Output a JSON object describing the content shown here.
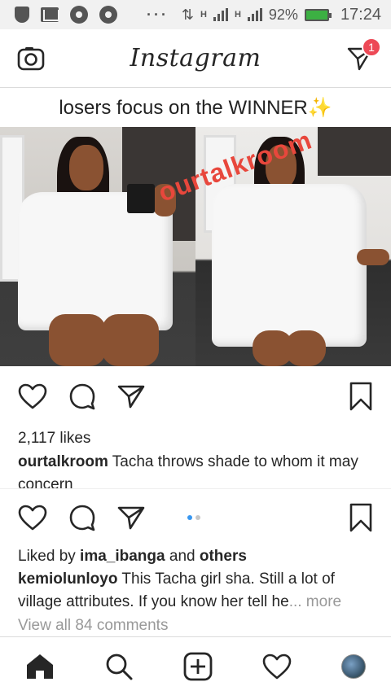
{
  "status_bar": {
    "battery_percent": "92%",
    "time": "17:24",
    "network_label_1": "H",
    "network_label_2": "H"
  },
  "header": {
    "logo": "Instagram",
    "notification_count": "1"
  },
  "post": {
    "banner_text": "losers focus on the WINNER✨",
    "watermark": "ourtalkroom",
    "likes": "2,117 likes",
    "caption_user": "ourtalkroom",
    "caption_text": " Tacha throws shade to whom it may concern"
  },
  "next_post": {
    "liked_by_prefix": "Liked by ",
    "liked_by_user": "ima_ibanga",
    "liked_by_mid": " and ",
    "liked_by_others": "others",
    "comment_user": "kemiolunloyo",
    "comment_text": " This Tacha girl sha. Still a lot of village attributes. If you know her tell he",
    "more_label": "... more",
    "view_all": "View all 84 comments"
  },
  "colors": {
    "accent_blue": "#3897f0",
    "badge_red": "#ed4956",
    "watermark_red": "#e8473c"
  }
}
